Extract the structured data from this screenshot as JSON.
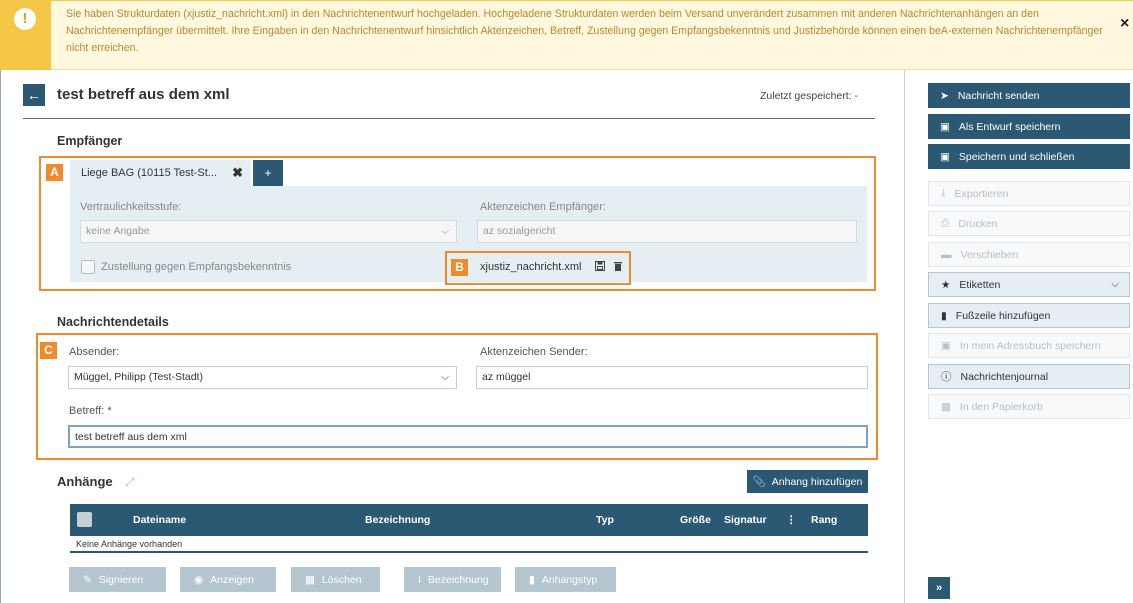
{
  "banner": {
    "icon": "exclamation-icon",
    "text": "Sie haben Strukturdaten (xjustiz_nachricht.xml) in den Nachrichtenentwurf hochgeladen. Hochgeladene Strukturdaten werden beim Versand unverändert zusammen mit anderen Nachrichtenanhängen an den Nachrichtenempfänger übermittelt. Ihre Eingaben in den Nachrichtenentwurf hinsichtlich Aktenzeichen, Betreff, Zustellung gegen Empfangsbekenntnis und Justizbehörde können einen beA-externen Nachrichtenempfänger nicht erreichen.",
    "close": "×"
  },
  "header": {
    "back": "←",
    "title": "test betreff aus dem xml",
    "saved": "Zuletzt gespeichert: -"
  },
  "recipients": {
    "heading": "Empfänger",
    "marker": "A",
    "tab_label": "Liege BAG (10115 Test-St...",
    "tab_close": "✖",
    "add": "+",
    "confidentiality_label": "Vertraulichkeitsstufe:",
    "confidentiality_value": "keine Angabe",
    "case_ref_label": "Aktenzeichen Empfänger:",
    "case_ref_placeholder": "az sozialgericht",
    "acknowledgement_label": "Zustellung gegen Empfangsbekenntnis",
    "xml_marker": "B",
    "xml_file": "xjustiz_nachricht.xml"
  },
  "details": {
    "heading": "Nachrichtendetails",
    "marker": "C",
    "sender_label": "Absender:",
    "sender_value": "Müggel, Philipp (Test-Stadt)",
    "sender_ref_label": "Aktenzeichen Sender:",
    "sender_ref_value": "az müggel",
    "subject_label": "Betreff: *",
    "subject_value": "test betreff aus dem xml"
  },
  "attachments": {
    "heading": "Anhänge",
    "add_button": "Anhang hinzufügen",
    "columns": [
      "Dateiname",
      "Bezeichnung",
      "Typ",
      "Größe",
      "Signatur",
      "⋮",
      "Rang"
    ],
    "empty": "Keine Anhänge vorhanden",
    "actions": [
      "Signieren",
      "Anzeigen",
      "Löschen",
      "Bezeichnung",
      "Anhangstyp"
    ]
  },
  "sidebar": {
    "send": "Nachricht senden",
    "save_draft": "Als Entwurf speichern",
    "save_close": "Speichern und schließen",
    "export": "Exportieren",
    "print": "Drucken",
    "move": "Verschieben",
    "labels": "Etiketten",
    "footer": "Fußzeile hinzufügen",
    "address_book": "In mein Adressbuch speichern",
    "journal": "Nachrichtenjournal",
    "trash": "In den Papierkorb",
    "collapse": "»"
  },
  "colors": {
    "primary": "#2b5873",
    "warning": "#f6c646",
    "marker": "#f08a2b",
    "panel": "#e5eef3"
  }
}
